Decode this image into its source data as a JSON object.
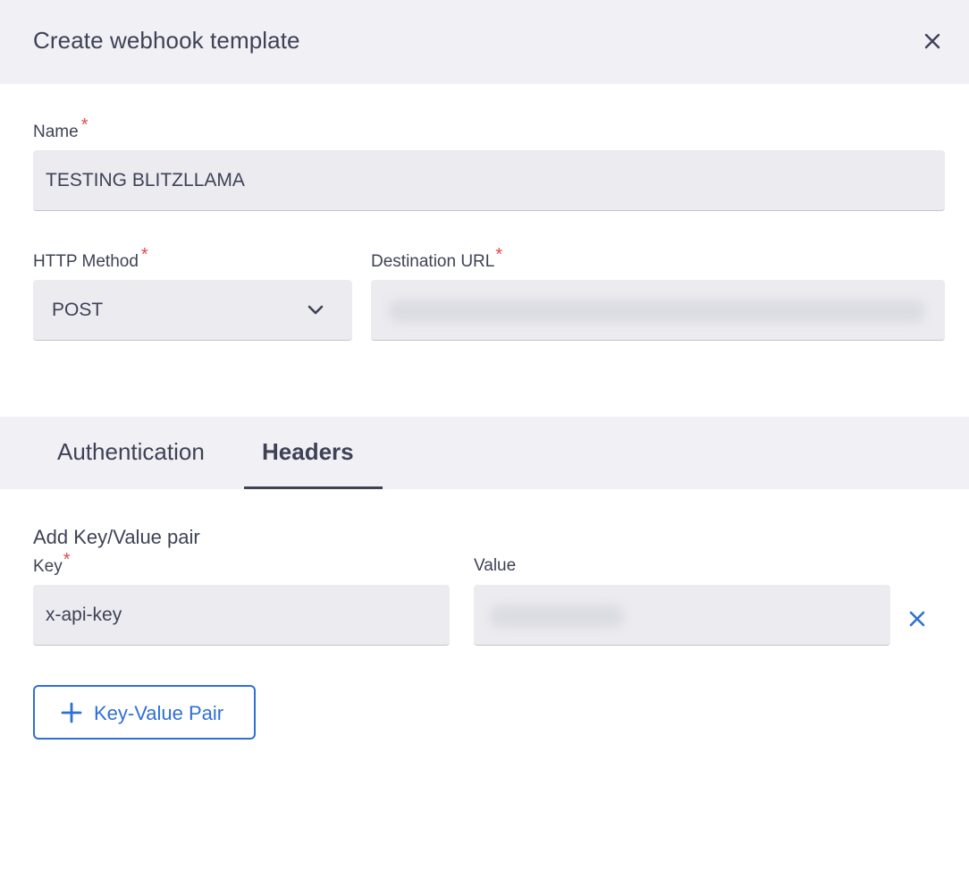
{
  "modal": {
    "title": "Create webhook template",
    "close_icon": "close-icon"
  },
  "name_field": {
    "label": "Name",
    "required_mark": "*",
    "value": "TESTING BLITZLLAMA"
  },
  "http_method": {
    "label": "HTTP Method",
    "required_mark": "*",
    "selected": "POST",
    "icon": "chevron-down-icon"
  },
  "destination_url": {
    "label": "Destination URL",
    "required_mark": "*",
    "value_state": "blurred"
  },
  "tabs": [
    {
      "label": "Authentication",
      "active": false
    },
    {
      "label": "Headers",
      "active": true
    }
  ],
  "headers_section": {
    "title": "Add Key/Value pair",
    "key_label": "Key",
    "key_required_mark": "*",
    "value_label": "Value",
    "pairs": [
      {
        "key": "x-api-key",
        "value_state": "blurred"
      }
    ],
    "add_button_label": "Key-Value Pair",
    "add_icon": "plus-icon",
    "remove_icon": "close-icon"
  },
  "colors": {
    "accent": "#2f6fd7",
    "required": "#e5484d",
    "text": "#3f4256",
    "header_bg": "#f0f0f5",
    "field_bg": "#ebebf0"
  }
}
